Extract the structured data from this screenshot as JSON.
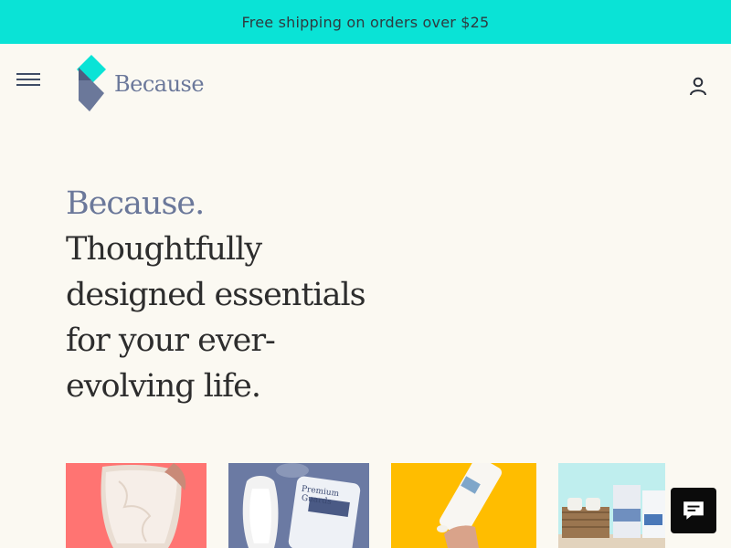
{
  "promo_bar": {
    "text": "Free shipping on orders over $25"
  },
  "header": {
    "menu_icon": "hamburger-menu-icon",
    "logo": {
      "text": "Because",
      "colors": {
        "teal": "#0ae3d6",
        "slate": "#6b789a"
      }
    },
    "account_icon": "user-account-icon"
  },
  "hero": {
    "brand": "Because.",
    "tagline": "Thoughtfully designed essentials for your ever-evolving life."
  },
  "products": [
    {
      "name": "underwear",
      "background": "#ff7472"
    },
    {
      "name": "pads",
      "background": "#6b7aa3",
      "package_text": "Premium Guards"
    },
    {
      "name": "cream",
      "background": "#ffbd00"
    },
    {
      "name": "boxes",
      "background": "#bfeeee"
    }
  ],
  "chat": {
    "icon": "chat-bubble-icon"
  },
  "colors": {
    "accent": "#0ae3d6",
    "brand": "#6b789a",
    "background": "#fbf9f2"
  }
}
